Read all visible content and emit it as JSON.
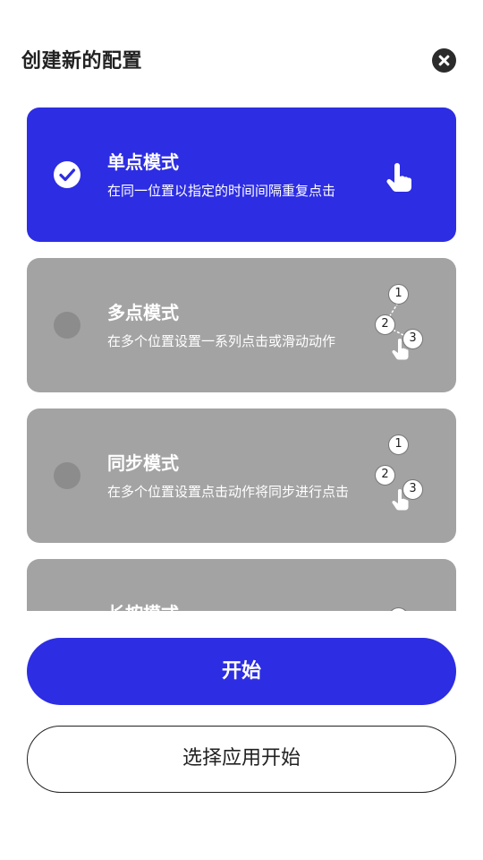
{
  "dialog": {
    "title": "创建新的配置",
    "close_icon": "close-icon"
  },
  "modes": [
    {
      "title": "单点模式",
      "desc": "在同一位置以指定的时间间隔重复点击",
      "selected": true
    },
    {
      "title": "多点模式",
      "desc": "在多个位置设置一系列点击或滑动动作",
      "selected": false
    },
    {
      "title": "同步模式",
      "desc": "在多个位置设置点击动作将同步进行点击",
      "selected": false
    },
    {
      "title": "长按模式",
      "desc": "",
      "selected": false
    }
  ],
  "step_labels": [
    "1",
    "2",
    "3"
  ],
  "buttons": {
    "start": "开始",
    "choose_app_start": "选择应用开始"
  },
  "colors": {
    "accent": "#2d2de3",
    "card_inactive": "#a3a3a3",
    "radio_inactive": "#8c8c8c"
  }
}
